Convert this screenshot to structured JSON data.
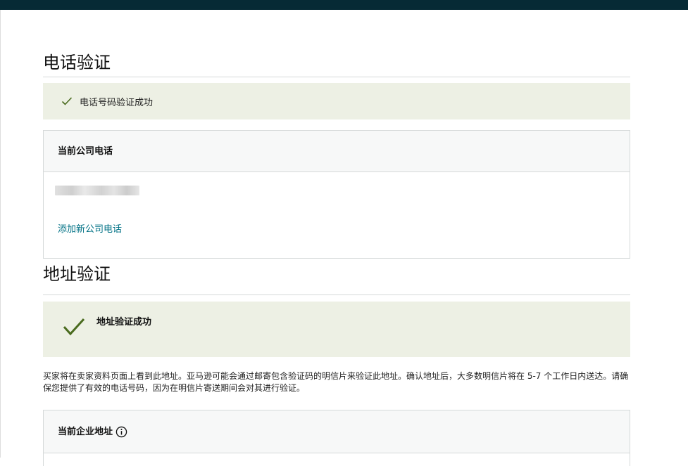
{
  "phone": {
    "title": "电话验证",
    "success_message": "电话号码验证成功",
    "card_title": "当前公司电话",
    "add_link": "添加新公司电话"
  },
  "address": {
    "title": "地址验证",
    "success_message": "地址验证成功",
    "description": "买家将在卖家资料页面上看到此地址。亚马逊可能会通过邮寄包含验证码的明信片来验证此地址。确认地址后，大多数明信片将在 5-7 个工作日内送达。请确保您提供了有效的电话号码，因为在明信片寄送期间会对其进行验证。",
    "card_title": "当前企业地址"
  },
  "icons": {
    "success": "check-icon",
    "info": "info-icon"
  },
  "colors": {
    "topbar": "#062a35",
    "success_bg": "#edf0e4",
    "check": "#4a6b1e",
    "link": "#007185"
  }
}
